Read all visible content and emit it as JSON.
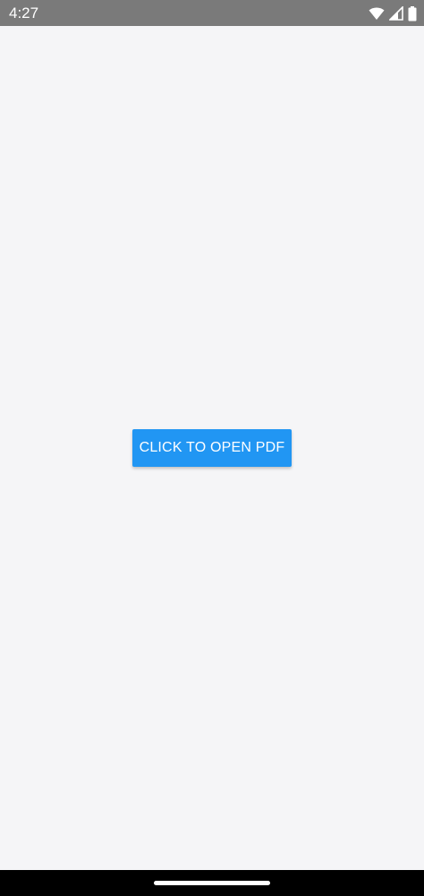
{
  "status_bar": {
    "time": "4:27",
    "icons": [
      "wifi-icon",
      "cellular-signal-icon",
      "battery-icon"
    ]
  },
  "main": {
    "open_pdf_button_label": "CLICK TO OPEN PDF"
  },
  "colors": {
    "status_bar_bg": "#7a7a7a",
    "content_bg": "#f5f5f7",
    "button_bg": "#2196f3",
    "button_text": "#ffffff",
    "nav_bar_bg": "#000000"
  }
}
